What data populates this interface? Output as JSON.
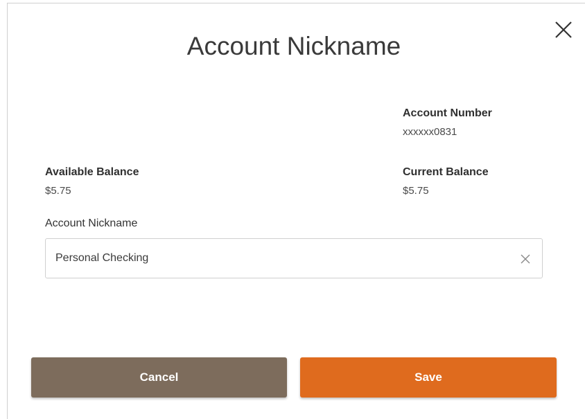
{
  "dialog": {
    "title": "Account Nickname"
  },
  "account_number": {
    "label": "Account Number",
    "value": "xxxxxx0831"
  },
  "available_balance": {
    "label": "Available Balance",
    "value": "$5.75"
  },
  "current_balance": {
    "label": "Current Balance",
    "value": "$5.75"
  },
  "nickname_input": {
    "label": "Account Nickname",
    "value": "Personal Checking",
    "placeholder": ""
  },
  "buttons": {
    "cancel_label": "Cancel",
    "save_label": "Save"
  },
  "colors": {
    "cancel": "#7d6c5c",
    "save": "#df6b1e"
  },
  "icons": {
    "close": "close-icon",
    "clear": "clear-input-icon"
  }
}
